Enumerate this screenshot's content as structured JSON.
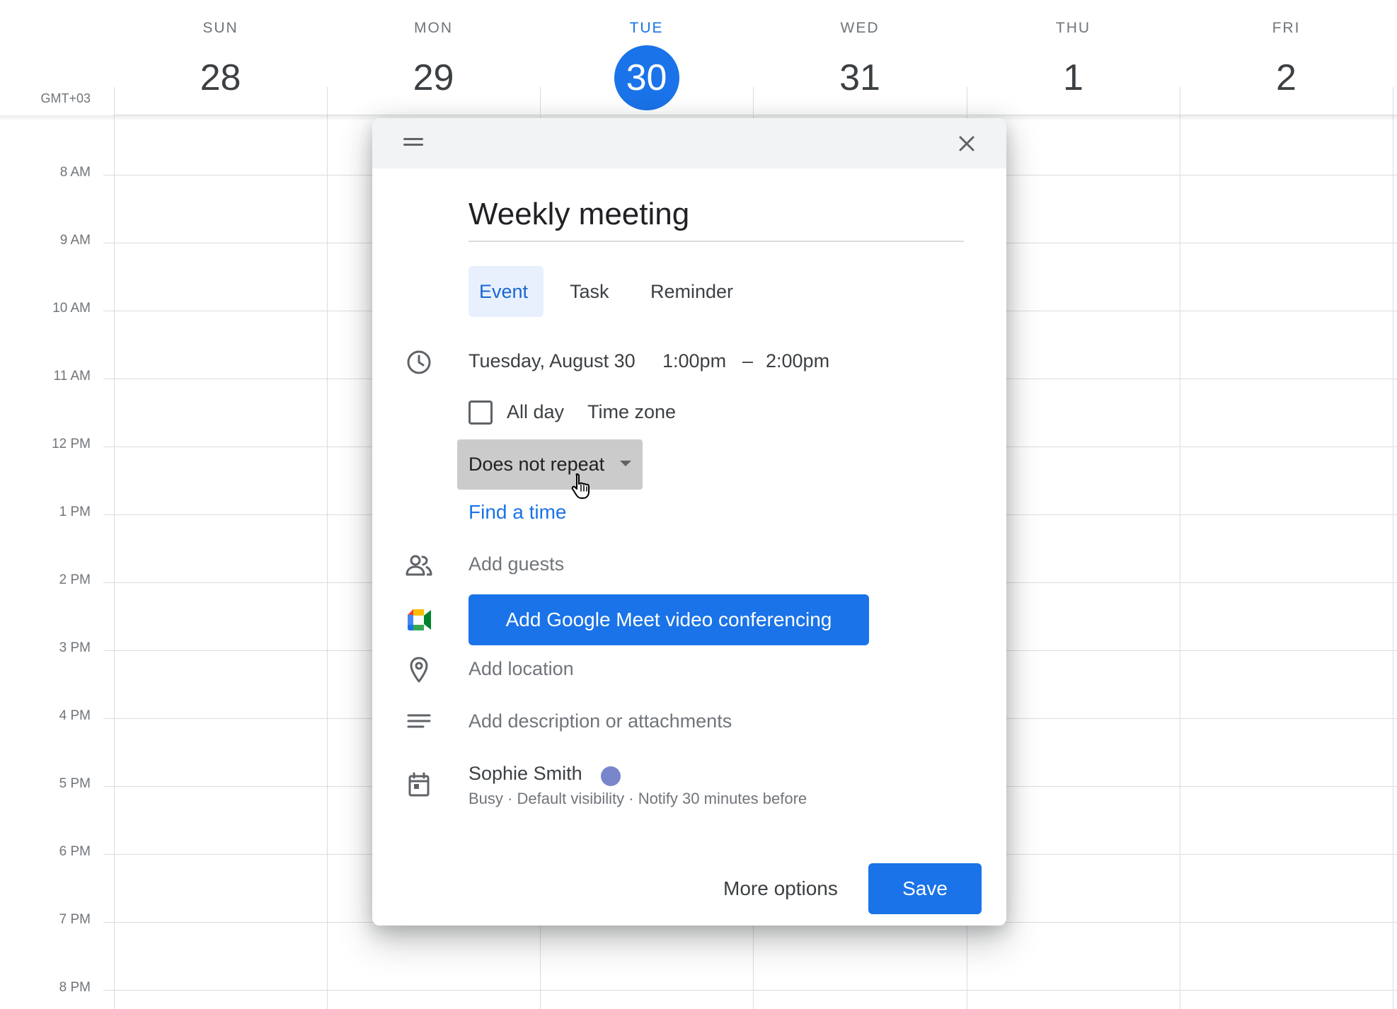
{
  "calendar": {
    "timezone": "GMT+03",
    "days": [
      {
        "dow": "SUN",
        "date": "28",
        "today": false
      },
      {
        "dow": "MON",
        "date": "29",
        "today": false
      },
      {
        "dow": "TUE",
        "date": "30",
        "today": true
      },
      {
        "dow": "WED",
        "date": "31",
        "today": false
      },
      {
        "dow": "THU",
        "date": "1",
        "today": false
      },
      {
        "dow": "FRI",
        "date": "2",
        "today": false
      }
    ],
    "hours": [
      "8 AM",
      "9 AM",
      "10 AM",
      "11 AM",
      "12 PM",
      "1 PM",
      "2 PM",
      "3 PM",
      "4 PM",
      "5 PM",
      "6 PM",
      "7 PM",
      "8 PM"
    ],
    "today_color": "#1a73e8"
  },
  "dialog": {
    "title_value": "Weekly meeting",
    "tabs": [
      {
        "label": "Event",
        "active": true
      },
      {
        "label": "Task",
        "active": false
      },
      {
        "label": "Reminder",
        "active": false
      }
    ],
    "date": "Tuesday, August 30",
    "start_time": "1:00pm",
    "separator": "–",
    "end_time": "2:00pm",
    "all_day_label": "All day",
    "all_day_checked": false,
    "time_zone_label": "Time zone",
    "repeat_value": "Does not repeat",
    "find_time_label": "Find a time",
    "add_guests_label": "Add guests",
    "meet_button_label": "Add Google Meet video conferencing",
    "add_location_label": "Add location",
    "add_description_label": "Add description or attachments",
    "calendar_owner": "Sophie Smith",
    "calendar_color": "#7986cb",
    "status_busy": "Busy",
    "status_visibility": "Default visibility",
    "status_notify": "Notify 30 minutes before",
    "status_separator": "·",
    "more_options_label": "More options",
    "save_label": "Save",
    "accent_color": "#1a73e8",
    "icons": [
      "drag-handle-icon",
      "close-icon",
      "clock-icon",
      "people-icon",
      "google-meet-icon",
      "location-pin-icon",
      "notes-icon",
      "calendar-icon",
      "pointer-cursor-icon",
      "dropdown-caret-icon"
    ]
  }
}
